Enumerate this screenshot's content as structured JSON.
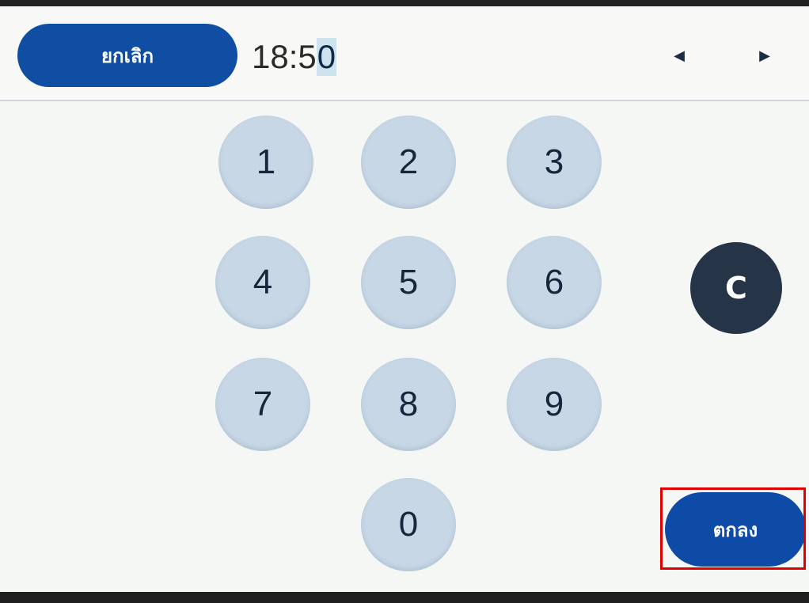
{
  "header": {
    "cancel_label": "ยกเลิก",
    "time_prefix": "18:5",
    "time_cursor_digit": "0",
    "prev_arrow": "◀",
    "next_arrow": "▶"
  },
  "keypad": {
    "keys": [
      "1",
      "2",
      "3",
      "4",
      "5",
      "6",
      "7",
      "8",
      "9",
      "0"
    ],
    "clear_label": "C"
  },
  "footer": {
    "ok_label": "ตกลง"
  },
  "colors": {
    "primary_blue": "#0f4ea2",
    "key_bg": "#c7d7e6",
    "clear_bg": "#263448",
    "highlight": "#e00000"
  }
}
